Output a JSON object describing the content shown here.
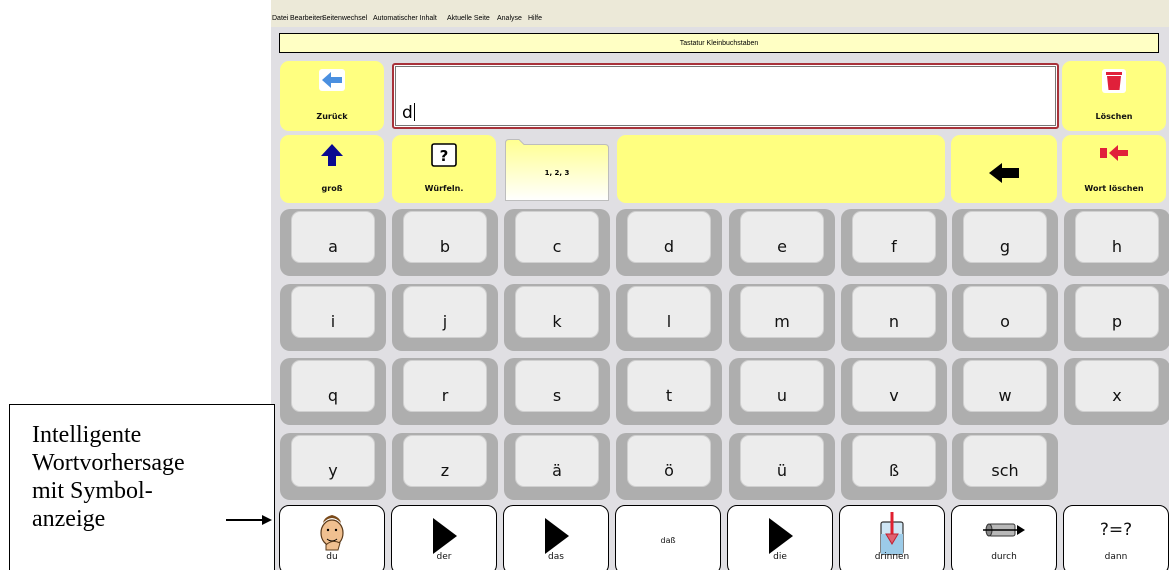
{
  "menu": [
    "Datei",
    "Bearbeiten",
    "Seitenwechsel",
    "Automatischer Inhalt",
    "Aktuelle Seite",
    "Analyse",
    "Hilfe"
  ],
  "page_title": "Tastatur Kleinbuchstaben",
  "text_field": {
    "value": "d"
  },
  "buttons": {
    "back": "Zurück",
    "delete": "Löschen",
    "shift": "groß",
    "dice": "Würfeln.",
    "numbers_folder": "1, 2, 3",
    "delete_word": "Wort löschen"
  },
  "keys": [
    [
      "a",
      "b",
      "c",
      "d",
      "e",
      "f",
      "g",
      "h"
    ],
    [
      "i",
      "j",
      "k",
      "l",
      "m",
      "n",
      "o",
      "p"
    ],
    [
      "q",
      "r",
      "s",
      "t",
      "u",
      "v",
      "w",
      "x"
    ],
    [
      "y",
      "z",
      "ä",
      "ö",
      "ü",
      "ß",
      "sch"
    ]
  ],
  "predictions": [
    "du",
    "der",
    "das",
    "daß",
    "die",
    "drinnen",
    "durch",
    "dann"
  ],
  "prediction_icons": [
    "pointing-person-icon",
    "play-triangle-icon",
    "play-triangle-icon",
    "",
    "play-triangle-icon",
    "container-arrow-icon",
    "pipe-arrow-icon",
    "question-equals-icon"
  ],
  "question_symbol": "?=?",
  "dice_symbol": "?",
  "annotation": "Intelligente\nWortvorhersage\nmit Symbol-\nanzeige",
  "colors": {
    "button_yellow": "#ffff80",
    "title_bg": "#ffffc4",
    "text_border": "#a8323a",
    "key_face": "#ececec",
    "key_shadow": "#aeaeae",
    "app_bg": "#e0dfe3"
  }
}
